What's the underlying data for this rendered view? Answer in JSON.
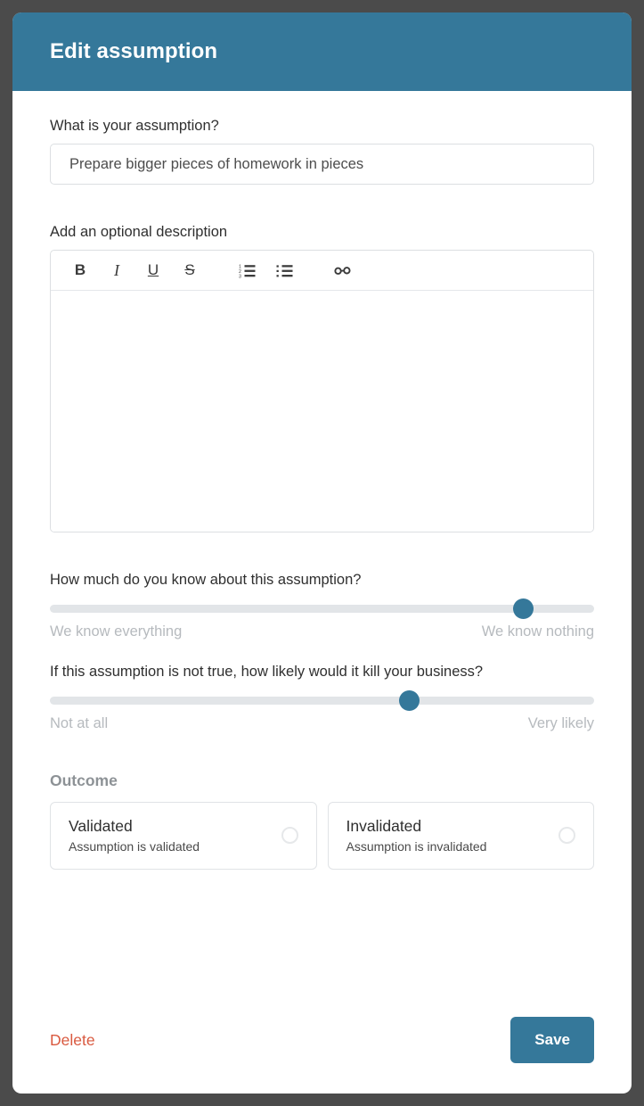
{
  "modal": {
    "title": "Edit assumption"
  },
  "assumption": {
    "label": "What is your assumption?",
    "value": "Prepare bigger pieces of homework in pieces",
    "placeholder": "What is your assumption?"
  },
  "description": {
    "label": "Add an optional description",
    "value": "",
    "placeholder": "",
    "toolbar": {
      "bold": "B",
      "italic": "I",
      "underline": "U",
      "strikethrough": "S",
      "ordered_list": "ordered-list-icon",
      "unordered_list": "unordered-list-icon",
      "link": "link-icon"
    }
  },
  "knowledge_slider": {
    "label": "How much do you know about this assumption?",
    "left_label": "We know everything",
    "right_label": "We know nothing",
    "value_percent": 87
  },
  "risk_slider": {
    "label": "If this assumption is not true, how likely would it kill your business?",
    "left_label": "Not at all",
    "right_label": "Very likely",
    "value_percent": 66
  },
  "outcome": {
    "title": "Outcome",
    "options": [
      {
        "name": "Validated",
        "description": "Assumption is validated",
        "selected": false
      },
      {
        "name": "Invalidated",
        "description": "Assumption is invalidated",
        "selected": false
      }
    ]
  },
  "footer": {
    "delete_label": "Delete",
    "save_label": "Save"
  },
  "colors": {
    "accent": "#35789a",
    "danger": "#d9593f",
    "backdrop": "#4b4b4b",
    "muted": "#b6babe",
    "track": "#e2e5e8"
  }
}
